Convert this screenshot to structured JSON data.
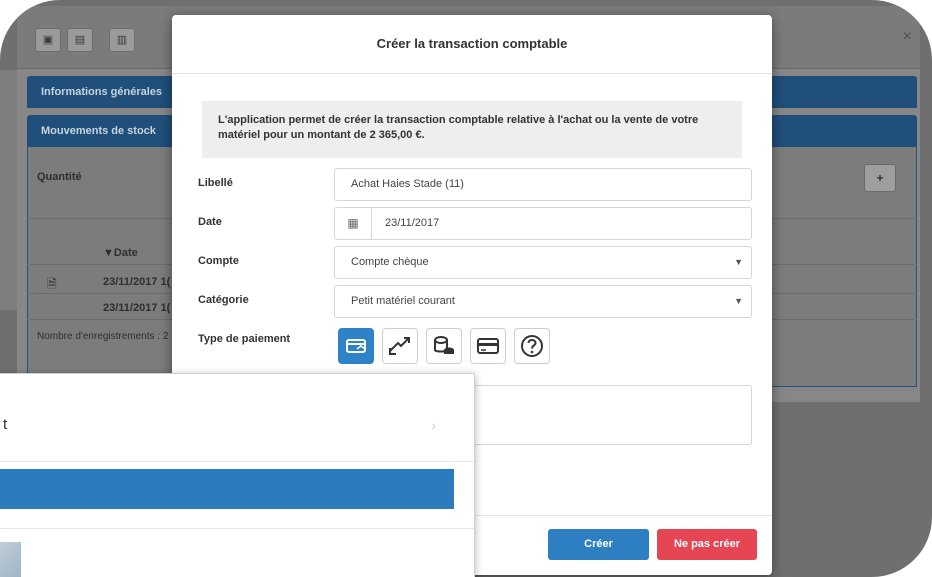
{
  "background": {
    "toolbar_icons": [
      "image-icon",
      "save-icon",
      "trash-icon"
    ],
    "close_label": "×",
    "panels": [
      {
        "title": "Informations générales"
      },
      {
        "title": "Mouvements de stock"
      }
    ],
    "quantity_label": "Quantité",
    "table_header_date": "▼Date",
    "rows": [
      {
        "date": "23/11/2017 1("
      },
      {
        "date": "23/11/2017 1("
      }
    ],
    "records_label": "Nombre d'enregistrements : 2",
    "add_label": "+"
  },
  "modal": {
    "title": "Créer la transaction comptable",
    "info": "L'application permet de créer la transaction comptable relative à l'achat ou la vente de votre matériel pour un montant de 2 365,00 €.",
    "fields": {
      "libelle_label": "Libellé",
      "libelle_value": "Achat Haies Stade (11)",
      "date_label": "Date",
      "date_value": "23/11/2017",
      "compte_label": "Compte",
      "compte_value": "Compte chèque",
      "categorie_label": "Catégorie",
      "categorie_value": "Petit matériel courant",
      "paiement_label": "Type de paiement"
    },
    "payment_types": [
      {
        "icon": "card-swipe-icon",
        "selected": true
      },
      {
        "icon": "transfer-icon",
        "selected": false
      },
      {
        "icon": "coins-icon",
        "selected": false
      },
      {
        "icon": "credit-card-icon",
        "selected": false
      },
      {
        "icon": "question-icon",
        "selected": false
      }
    ],
    "buttons": {
      "create": "Créer",
      "no_create": "Ne pas créer"
    },
    "accent": "#2e7fc2",
    "danger": "#e64553"
  },
  "dialog2": {
    "title_fragment": "t",
    "nav_icon": "chevron-right-icon"
  }
}
